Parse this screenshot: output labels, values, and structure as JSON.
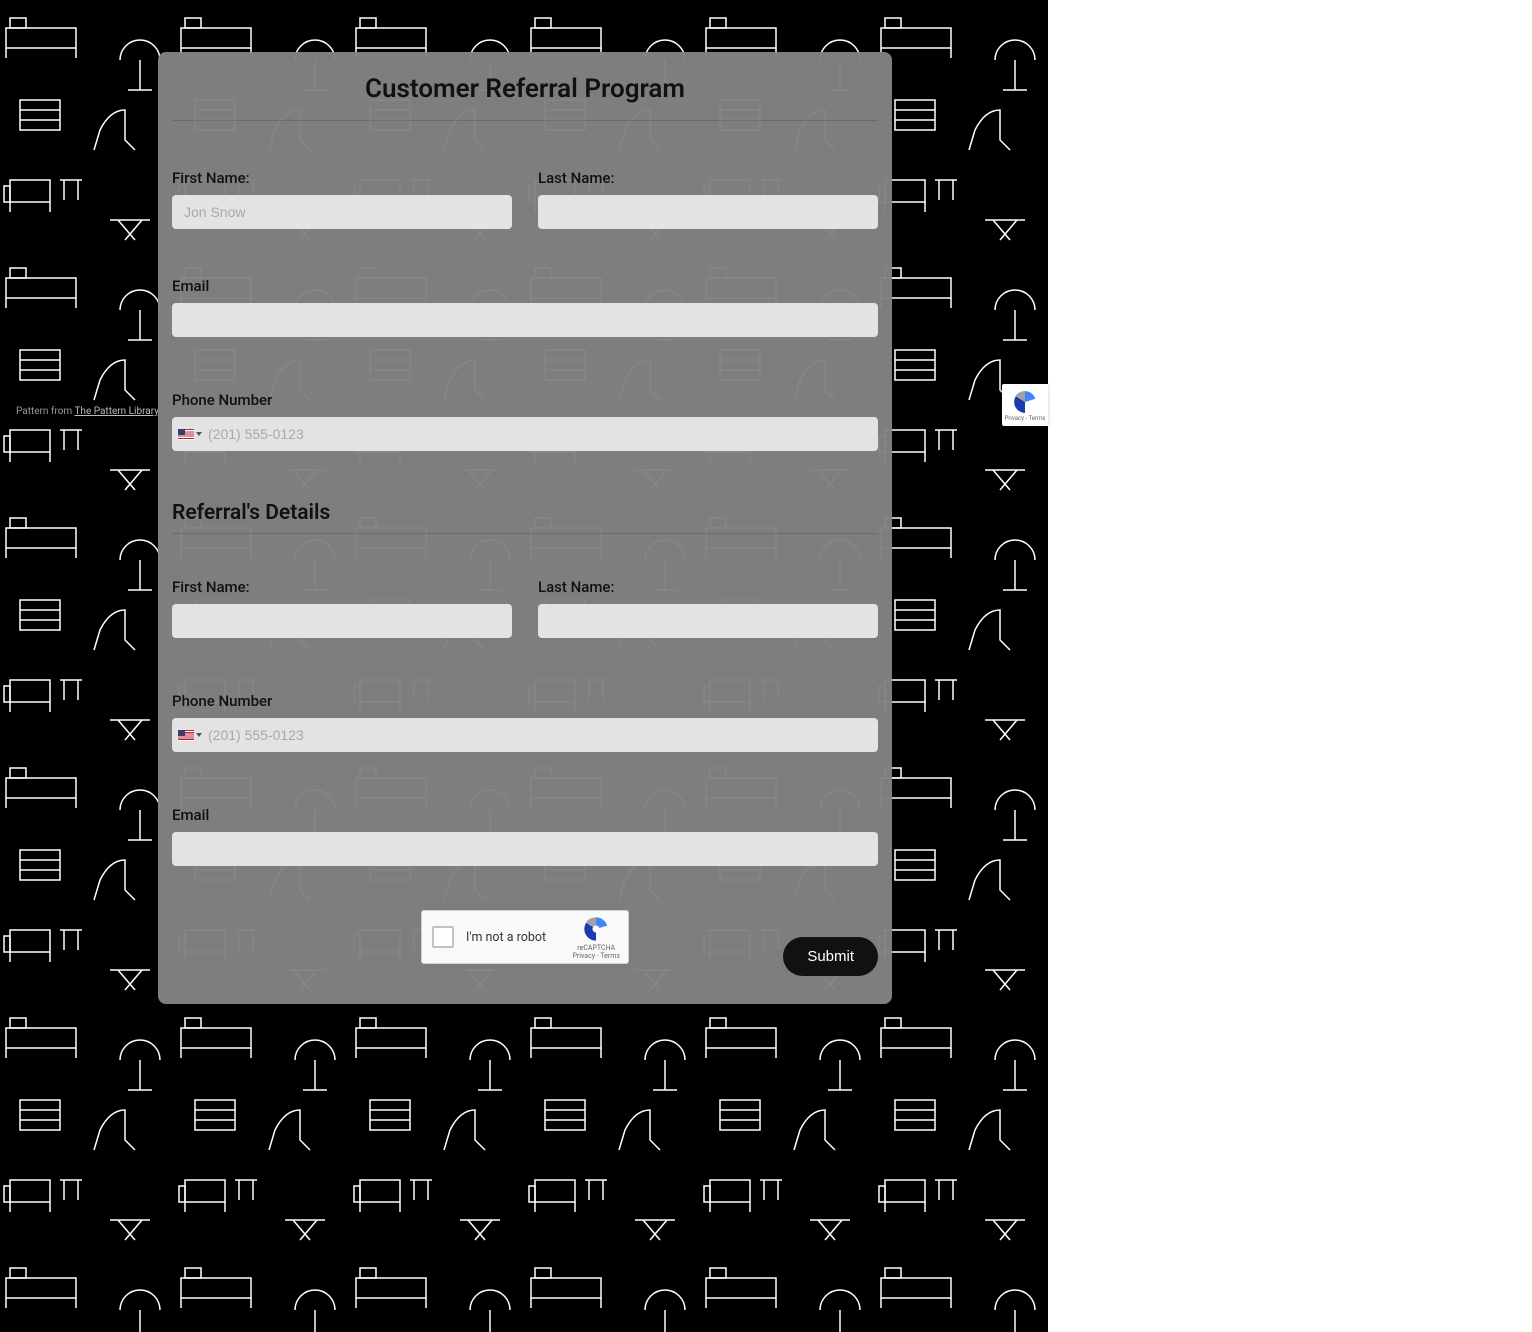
{
  "pattern_credit": {
    "prefix": "Pattern from ",
    "link_text": "The Pattern Library"
  },
  "form": {
    "title": "Customer Referral Program",
    "customer": {
      "first_name": {
        "label": "First Name:",
        "placeholder": "Jon Snow",
        "value": ""
      },
      "last_name": {
        "label": "Last Name:",
        "placeholder": "",
        "value": ""
      },
      "email": {
        "label": "Email",
        "placeholder": "",
        "value": ""
      },
      "phone": {
        "label": "Phone Number",
        "placeholder": "(201) 555-0123",
        "value": "",
        "country": "US"
      }
    },
    "referral_heading": "Referral's Details",
    "referral": {
      "first_name": {
        "label": "First Name:",
        "placeholder": "",
        "value": ""
      },
      "last_name": {
        "label": "Last Name:",
        "placeholder": "",
        "value": ""
      },
      "phone": {
        "label": "Phone Number",
        "placeholder": "(201) 555-0123",
        "value": "",
        "country": "US"
      },
      "email": {
        "label": "Email",
        "placeholder": "",
        "value": ""
      }
    },
    "captcha": {
      "label": "I'm not a robot",
      "brand": "reCAPTCHA",
      "legal": "Privacy - Terms"
    },
    "submit_label": "Submit"
  },
  "recaptcha_badge": {
    "legal": "Privacy - Terms"
  }
}
